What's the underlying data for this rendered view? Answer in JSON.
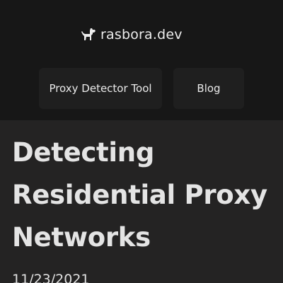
{
  "header": {
    "brand": {
      "icon": "dog-icon",
      "text": "rasbora.dev"
    },
    "nav": [
      {
        "label": "Proxy Detector Tool"
      },
      {
        "label": "Blog"
      }
    ]
  },
  "article": {
    "title": "Detecting Residential Proxy Networks",
    "date": "11/23/2021"
  },
  "colors": {
    "header_bg": "#171717",
    "page_bg": "#242323",
    "button_bg": "#1f1f1f",
    "text": "#e6e6e6"
  }
}
